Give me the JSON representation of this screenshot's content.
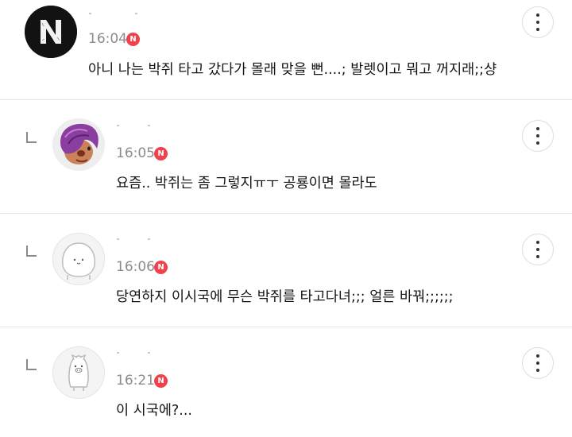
{
  "comments": [
    {
      "avatar_icon": "n-logo-avatar-icon",
      "time": "16:04",
      "badge": "N",
      "text": "아니 나는 박쥐 타고 갔다가 몰래 맞을 뻔....; 발렛이고 뭐고 꺼지래;;샹",
      "is_reply": false
    },
    {
      "avatar_icon": "purple-hair-character-avatar-icon",
      "time": "16:05",
      "badge": "N",
      "text": "요즘.. 박쥐는 좀 그렇지ㅠㅜ 공룡이면 몰라도",
      "is_reply": true
    },
    {
      "avatar_icon": "round-blob-avatar-icon",
      "time": "16:06",
      "badge": "N",
      "text": "당연하지 이시국에 무슨 박쥐를 타고다녀;;; 얼른 바꿔;;;;;;",
      "is_reply": true
    },
    {
      "avatar_icon": "pig-avatar-icon",
      "time": "16:21",
      "badge": "N",
      "text": "이 시국에?...",
      "is_reply": true
    }
  ],
  "colors": {
    "badge": "#f0414d",
    "divider": "#e6e6e6",
    "time": "#8c8c8c"
  }
}
